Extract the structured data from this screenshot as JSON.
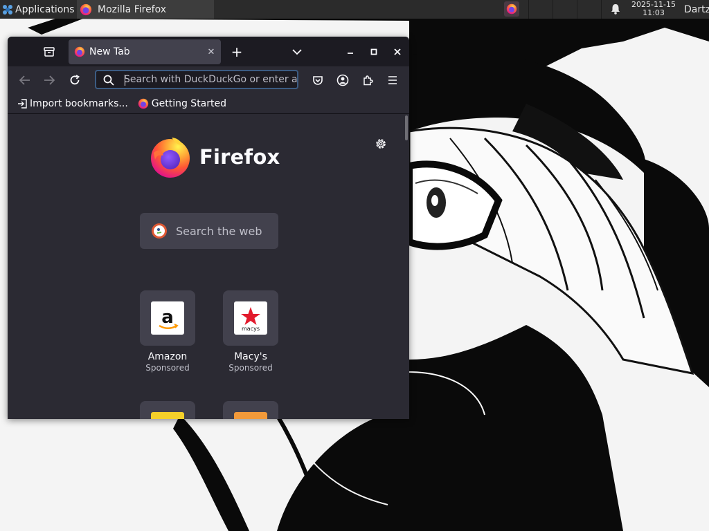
{
  "panel": {
    "applications_label": "Applications",
    "window_title": "Mozilla Firefox",
    "date": "2025-11-15",
    "time": "11:03",
    "user": "Dartz"
  },
  "browser": {
    "tab_title": "New Tab",
    "url_placeholder": "Search with DuckDuckGo or enter address",
    "bookmarks": [
      "Import bookmarks...",
      "Getting Started"
    ],
    "wordmark": "Firefox",
    "web_search_placeholder": "Search the web",
    "shortcuts": [
      {
        "name": "Amazon",
        "label": "Sponsored",
        "icon": "amazon-logo"
      },
      {
        "name": "Macy's",
        "label": "Sponsored",
        "icon": "macys-logo"
      }
    ]
  },
  "colors": {
    "panel": "#2b2b2b",
    "toolbar": "#2b2a33",
    "tabbar": "#1c1b22",
    "tab_active": "#42414d",
    "accent_focus": "#3b5b82"
  }
}
